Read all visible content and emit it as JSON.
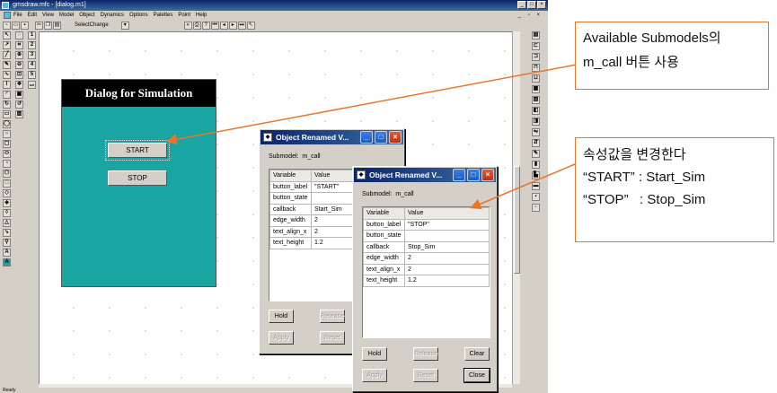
{
  "window": {
    "title": "gmsdraw.mfc - [dialog.m1]",
    "status": "Ready",
    "controls": [
      "_",
      "□",
      "×"
    ],
    "mdi_controls": "_ ▫ ×"
  },
  "menu": {
    "items": [
      "File",
      "Edit",
      "View",
      "Model",
      "Object",
      "Dynamics",
      "Options",
      "Palettes",
      "Point",
      "Help"
    ]
  },
  "toolbar": {
    "select_value": "SelectChange"
  },
  "left_tools": {
    "numbers": [
      "1",
      "2",
      "3",
      "4",
      "5"
    ],
    "extra": "sel"
  },
  "sim_dialog": {
    "title": "Dialog for Simulation",
    "start_label": "START",
    "stop_label": "STOP"
  },
  "dialog1": {
    "title": "Object Renamed V...",
    "submodel_label": "Submodel:",
    "submodel_value": "m_call",
    "headers": [
      "Variable",
      "Value"
    ],
    "rows": [
      [
        "button_label",
        "\"START\""
      ],
      [
        "button_state",
        ""
      ],
      [
        "callback",
        "Start_Sim"
      ],
      [
        "edge_width",
        "2"
      ],
      [
        "text_align_x",
        "2"
      ],
      [
        "text_height",
        "1.2"
      ]
    ],
    "hold_label": "Hold",
    "release_label": "Release",
    "apply_label": "Apply",
    "reset_label": "Reset"
  },
  "dialog2": {
    "title": "Object Renamed V...",
    "submodel_label": "Submodel:",
    "submodel_value": "m_call",
    "headers": [
      "Variable",
      "Value"
    ],
    "rows": [
      [
        "button_label",
        "\"STOP\""
      ],
      [
        "button_state",
        ""
      ],
      [
        "callback",
        "Stop_Sim"
      ],
      [
        "edge_width",
        "2"
      ],
      [
        "text_align_x",
        "2"
      ],
      [
        "text_height",
        "1.2"
      ]
    ],
    "hold_label": "Hold",
    "release_label": "Release",
    "clear_label": "Clear",
    "apply_label": "Apply",
    "reset_label": "Reset",
    "close_label": "Close"
  },
  "annotation1": {
    "line1": "Available Submodels의",
    "line2": "m_call 버튼 사용"
  },
  "annotation2": {
    "line1": "속성값을 변경한다",
    "line2": "“START” : Start_Sim",
    "line3": "“STOP”   : Stop_Sim"
  },
  "colors": {
    "sim_panel": "#19a5a2",
    "annotation_border": "#e8752a",
    "titlebar": "#0a246a"
  }
}
